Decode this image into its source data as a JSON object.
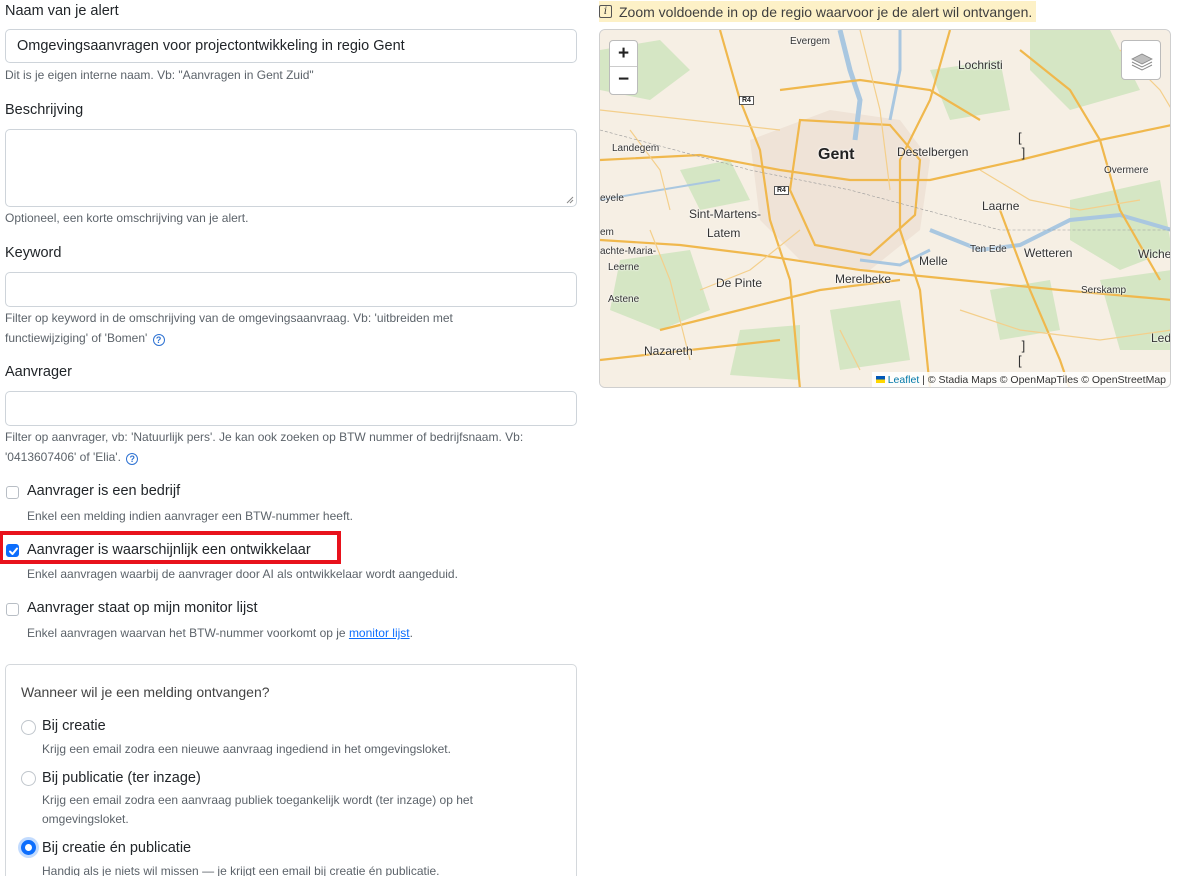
{
  "form": {
    "name": {
      "label": "Naam van je alert",
      "value": "Omgevingsaanvragen voor projectontwikkeling in regio Gent",
      "help": "Dit is je eigen interne naam. Vb: \"Aanvragen in Gent Zuid\""
    },
    "description": {
      "label": "Beschrijving",
      "value": "",
      "help": "Optioneel, een korte omschrijving van je alert."
    },
    "keyword": {
      "label": "Keyword",
      "value": "",
      "help": "Filter op keyword in de omschrijving van de omgevingsaanvraag. Vb: 'uitbreiden met functiewijziging' of 'Bomen'"
    },
    "applicant": {
      "label": "Aanvrager",
      "value": "",
      "help": "Filter op aanvrager, vb: 'Natuurlijk pers'. Je kan ook zoeken op BTW nummer of bedrijfsnaam. Vb: '0413607406' of 'Elia'."
    },
    "checkboxes": [
      {
        "label": "Aanvrager is een bedrijf",
        "help": "Enkel een melding indien aanvrager een BTW-nummer heeft.",
        "checked": false
      },
      {
        "label": "Aanvrager is waarschijnlijk een ontwikkelaar",
        "help": "Enkel aanvragen waarbij de aanvrager door AI als ontwikkelaar wordt aangeduid.",
        "checked": true
      },
      {
        "label": "Aanvrager staat op mijn monitor lijst",
        "help_prefix": "Enkel aanvragen waarvan het BTW-nummer voorkomt op je ",
        "help_link": "monitor lijst",
        "help_suffix": ".",
        "checked": false
      }
    ],
    "notify": {
      "title": "Wanneer wil je een melding ontvangen?",
      "options": [
        {
          "label": "Bij creatie",
          "help": "Krijg een email zodra een nieuwe aanvraag ingediend in het omgevingsloket.",
          "selected": false
        },
        {
          "label": "Bij publicatie (ter inzage)",
          "help": "Krijg een email zodra een aanvraag publiek toegankelijk wordt (ter inzage) op het omgevingsloket.",
          "selected": false
        },
        {
          "label": "Bij creatie én publicatie",
          "help": "Handig als je niets wil missen — je krijgt een email bij creatie én publicatie.",
          "selected": true
        }
      ]
    }
  },
  "map": {
    "note": "Zoom voldoende in op de regio waarvoor je de alert wil ontvangen.",
    "zoom_in": "+",
    "zoom_out": "−",
    "places": [
      "Evergem",
      "Lochristi",
      "Landegem",
      "Gent",
      "Destelbergen",
      "Overmere",
      "eyele",
      "Sint-Martens-",
      "Latem",
      "Laarne",
      "em",
      "achte-Maria-",
      "Leerne",
      "Ten Ede",
      "Wetteren",
      "Wiche",
      "Melle",
      "De Pinte",
      "Merelbeke",
      "Astene",
      "Serskamp",
      "Nazareth",
      "Led"
    ],
    "road_signs": [
      "R4",
      "R4"
    ],
    "attribution_link": "Leaflet",
    "attribution_text": "| © Stadia Maps © OpenMapTiles © OpenStreetMap"
  },
  "colors": {
    "primary": "#0d6efd",
    "highlight": "#e8121c",
    "note_bg": "#fdf1c7"
  }
}
